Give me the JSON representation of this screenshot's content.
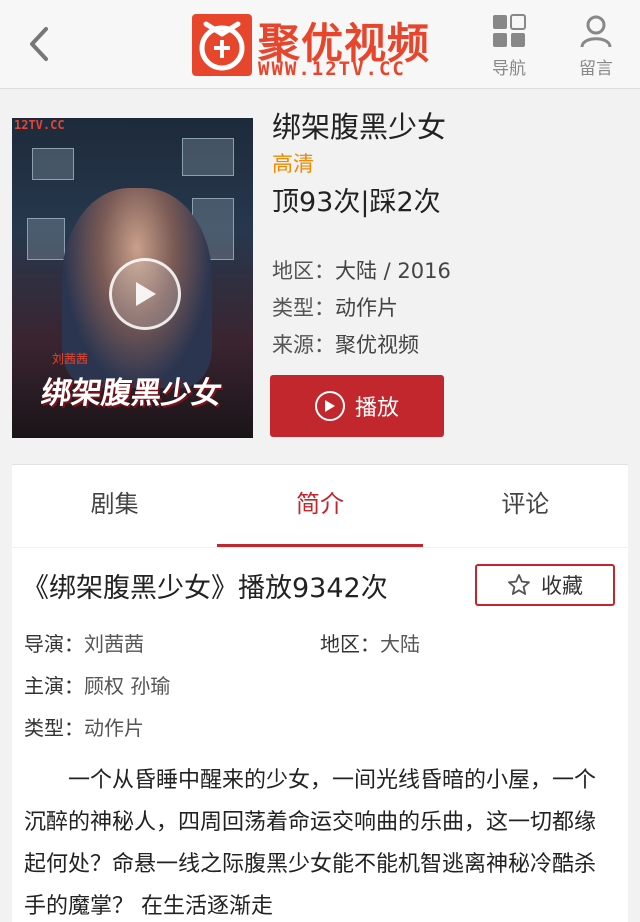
{
  "header": {
    "logo_name": "聚优视频",
    "logo_url": "WWW.12TV.CC",
    "nav_label": "导航",
    "message_label": "留言"
  },
  "movie": {
    "poster_tag": "12TV.CC",
    "poster_title": "绑架腹黑少女",
    "poster_name": "刘茜茜",
    "title": "绑架腹黑少女",
    "quality": "高清",
    "votes": "顶93次|踩2次",
    "region_label": "地区：",
    "region_value": "大陆 / 2016",
    "type_label": "类型：",
    "type_value": "动作片",
    "source_label": "来源：",
    "source_value": "聚优视频",
    "play_label": "播放"
  },
  "tabs": [
    {
      "label": "剧集"
    },
    {
      "label": "简介"
    },
    {
      "label": "评论"
    }
  ],
  "detail": {
    "play_count_title": "《绑架腹黑少女》播放9342次",
    "favorite_label": "收藏",
    "director_label": "导演：",
    "director_value": "刘茜茜",
    "region_label": "地区：",
    "region_value": "大陆",
    "cast_label": "主演：",
    "cast_value": "顾权 孙瑜",
    "type_label": "类型：",
    "type_value": "动作片",
    "synopsis": "一个从昏睡中醒来的少女，一间光线昏暗的小屋，一个沉醉的神秘人，四周回荡着命运交响曲的乐曲，这一切都缘起何处？命悬一线之际腹黑少女能不能机智逃离神秘冷酷杀手的魔掌？ 在生活逐渐走"
  },
  "colors": {
    "accent": "#c1272d",
    "logo": "#e8452d",
    "quality": "#f08a00"
  }
}
